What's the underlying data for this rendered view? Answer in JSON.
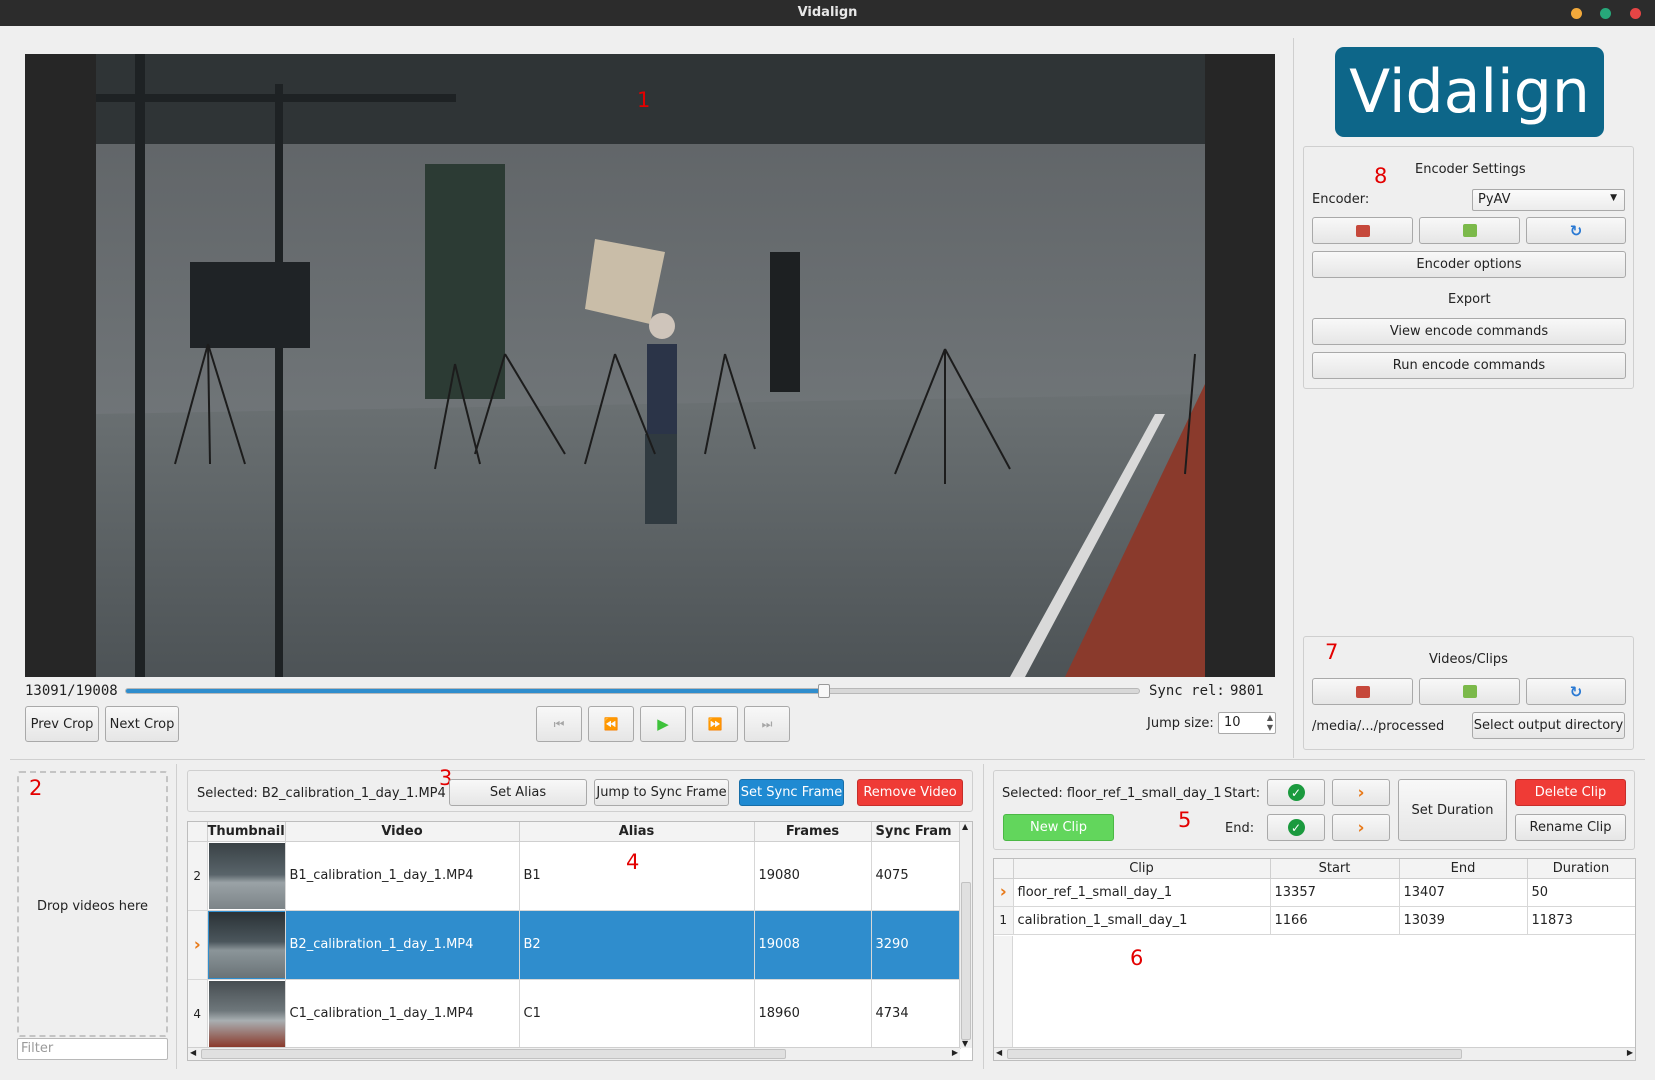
{
  "window": {
    "title": "Vidalign"
  },
  "markers": [
    "1",
    "2",
    "3",
    "4",
    "5",
    "6",
    "7",
    "8"
  ],
  "player": {
    "frame_counter": "13091/19008",
    "sync_rel_label": "Sync rel:",
    "sync_rel_value": "9801",
    "progress": 0.689,
    "prev_crop": "Prev Crop",
    "next_crop": "Next Crop",
    "jump_size_label": "Jump size:",
    "jump_size_value": "10"
  },
  "logo": {
    "text": "Vidalign",
    "color": "#0d6689"
  },
  "encoder": {
    "title": "Encoder Settings",
    "encoder_label": "Encoder:",
    "encoder_value": "PyAV",
    "options_label": "Encoder options",
    "export_label": "Export",
    "view_commands": "View encode commands",
    "run_commands": "Run encode commands"
  },
  "videos_clips": {
    "title": "Videos/Clips",
    "output_path": "/media/.../processed",
    "select_output": "Select output directory"
  },
  "dropzone": {
    "label": "Drop videos here",
    "filter_placeholder": "Filter"
  },
  "video_list": {
    "selected": "Selected: B2_calibration_1_day_1.MP4",
    "set_alias": "Set Alias",
    "jump_sync": "Jump to Sync Frame",
    "set_sync": "Set Sync Frame",
    "remove_video": "Remove Video",
    "columns": [
      "Thumbnail",
      "Video",
      "Alias",
      "Frames",
      "Sync Fram"
    ],
    "rows": [
      {
        "num": "2",
        "video": "B1_calibration_1_day_1.MP4",
        "alias": "B1",
        "frames": "19080",
        "sync": "4075"
      },
      {
        "num": "",
        "video": "B2_calibration_1_day_1.MP4",
        "alias": "B2",
        "frames": "19008",
        "sync": "3290"
      },
      {
        "num": "4",
        "video": "C1_calibration_1_day_1.MP4",
        "alias": "C1",
        "frames": "18960",
        "sync": "4734"
      }
    ]
  },
  "clips": {
    "selected": "Selected: floor_ref_1_small_day_1",
    "start_label": "Start:",
    "end_label": "End:",
    "set_duration": "Set Duration",
    "delete_clip": "Delete Clip",
    "rename_clip": "Rename Clip",
    "new_clip": "New Clip",
    "columns": [
      "Clip",
      "Start",
      "End",
      "Duration"
    ],
    "rows": [
      {
        "num": "",
        "clip": "floor_ref_1_small_day_1",
        "start": "13357",
        "end": "13407",
        "duration": "50"
      },
      {
        "num": "1",
        "clip": "calibration_1_small_day_1",
        "start": "1166",
        "end": "13039",
        "duration": "11873"
      }
    ]
  }
}
